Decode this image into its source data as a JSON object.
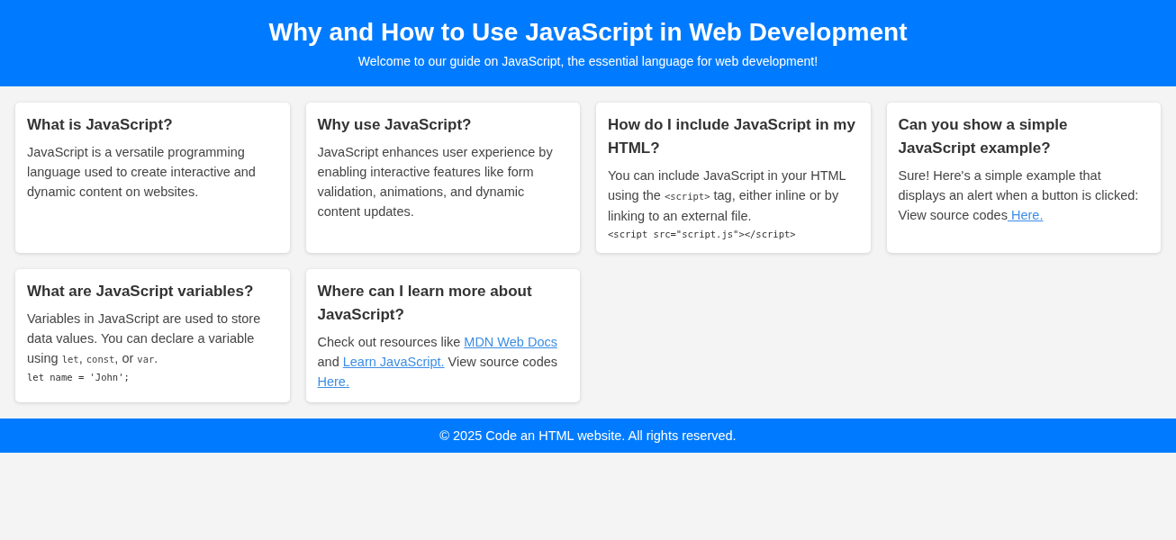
{
  "header": {
    "title": "Why and How to Use JavaScript in Web Development",
    "subtitle": "Welcome to our guide on JavaScript, the essential language for web development!"
  },
  "cards": [
    {
      "title": "What is JavaScript?",
      "blocks": [
        {
          "kind": "paragraph",
          "parts": [
            {
              "kind": "text",
              "text": "JavaScript is a versatile programming language used to create interactive and dynamic content on websites."
            }
          ]
        }
      ]
    },
    {
      "title": "Why use JavaScript?",
      "blocks": [
        {
          "kind": "paragraph",
          "parts": [
            {
              "kind": "text",
              "text": "JavaScript enhances user experience by enabling interactive features like form validation, animations, and dynamic content updates."
            }
          ]
        }
      ]
    },
    {
      "title": "How do I include JavaScript in my HTML?",
      "blocks": [
        {
          "kind": "paragraph",
          "parts": [
            {
              "kind": "text",
              "text": "You can include JavaScript in your HTML using the "
            },
            {
              "kind": "code",
              "text": "<script>"
            },
            {
              "kind": "text",
              "text": " tag, either inline or by linking to an external file."
            }
          ]
        },
        {
          "kind": "code_block",
          "text": "<script src=\"script.js\"></script>"
        }
      ]
    },
    {
      "title": "Can you show a simple JavaScript example?",
      "blocks": [
        {
          "kind": "paragraph",
          "parts": [
            {
              "kind": "text",
              "text": "Sure! Here's a simple example that displays an alert when a button is clicked:"
            }
          ]
        },
        {
          "kind": "paragraph",
          "parts": [
            {
              "kind": "text",
              "text": "View source codes"
            },
            {
              "kind": "link",
              "text": " Here."
            }
          ]
        }
      ]
    },
    {
      "title": "What are JavaScript variables?",
      "blocks": [
        {
          "kind": "paragraph",
          "parts": [
            {
              "kind": "text",
              "text": "Variables in JavaScript are used to store data values. You can declare a variable using "
            },
            {
              "kind": "code",
              "text": "let"
            },
            {
              "kind": "text",
              "text": ", "
            },
            {
              "kind": "code",
              "text": "const"
            },
            {
              "kind": "text",
              "text": ", or "
            },
            {
              "kind": "code",
              "text": "var"
            },
            {
              "kind": "text",
              "text": "."
            }
          ]
        },
        {
          "kind": "code_block",
          "text": "let name = 'John';"
        }
      ]
    },
    {
      "title": "Where can I learn more about JavaScript?",
      "blocks": [
        {
          "kind": "paragraph",
          "parts": [
            {
              "kind": "text",
              "text": "Check out resources like "
            },
            {
              "kind": "link",
              "text": "MDN Web Docs"
            },
            {
              "kind": "text",
              "text": " and "
            },
            {
              "kind": "link",
              "text": "Learn JavaScript."
            },
            {
              "kind": "text",
              "text": " View source codes"
            },
            {
              "kind": "link",
              "text": " Here."
            }
          ]
        }
      ]
    }
  ],
  "footer": {
    "text": "© 2025 Code an HTML website. All rights reserved."
  }
}
